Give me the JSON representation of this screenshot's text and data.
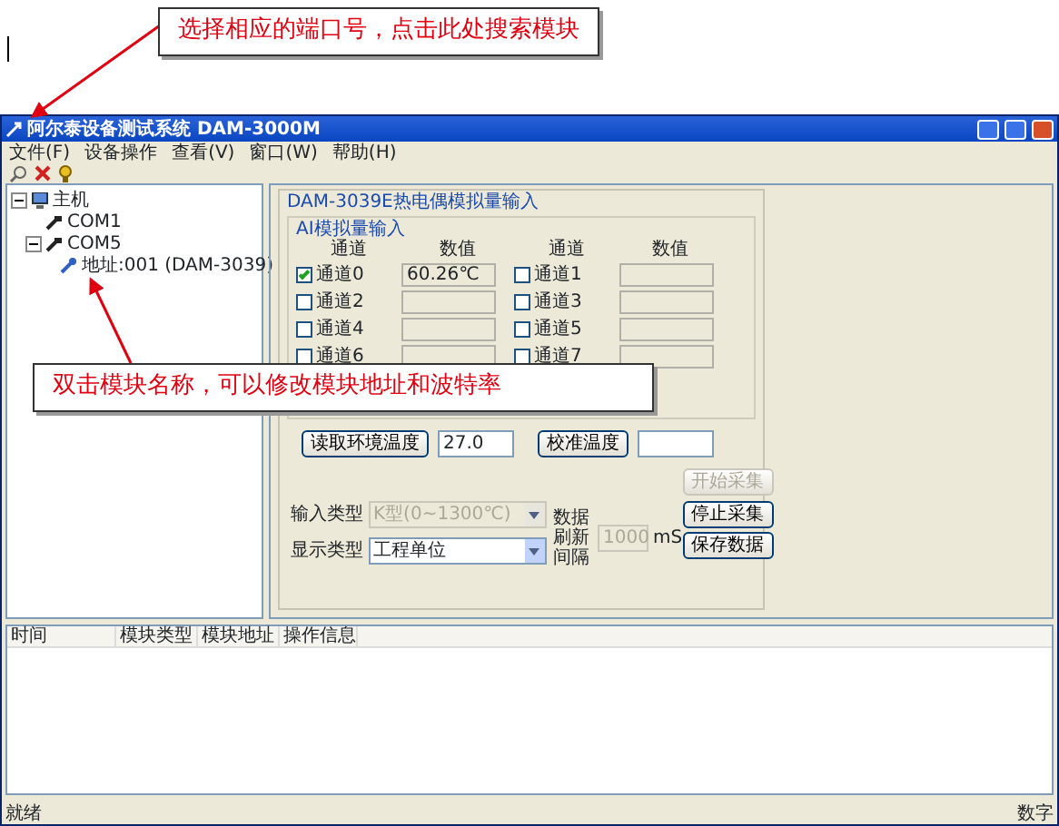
{
  "annotations": [
    {
      "text": "选择相应的端口号，点击此处搜索模块"
    },
    {
      "text": "双击模块名称，可以修改模块地址和波特率"
    }
  ],
  "window": {
    "title": "阿尔泰设备测试系统 DAM-3000M"
  },
  "menu": [
    "文件(F)",
    "设备操作",
    "查看(V)",
    "窗口(W)",
    "帮助(H)"
  ],
  "tree": [
    {
      "label": "主机",
      "expanded": true,
      "kind": "host",
      "children": [
        {
          "label": "COM1",
          "kind": "port"
        },
        {
          "label": "COM5",
          "kind": "port",
          "expanded": true,
          "children": [
            {
              "label": "地址:001 (DAM-3039)",
              "kind": "module"
            }
          ]
        }
      ]
    }
  ],
  "module_panel": {
    "title": "DAM-3039E热电偶模拟量输入",
    "group_title": "AI模拟量输入",
    "column_headers": [
      "通道",
      "数值",
      "通道",
      "数值"
    ],
    "channels": [
      {
        "label": "通道0",
        "checked": true,
        "value": "60.26℃"
      },
      {
        "label": "通道1",
        "checked": false
      },
      {
        "label": "通道2",
        "checked": false
      },
      {
        "label": "通道3",
        "checked": false
      },
      {
        "label": "通道4",
        "checked": false
      },
      {
        "label": "通道5",
        "checked": false
      },
      {
        "label": "通道6",
        "checked": false
      },
      {
        "label": "通道7",
        "checked": false
      }
    ],
    "ambient_button": "读取环境温度",
    "ambient_value": "27.0",
    "calibrate_button": "校准温度",
    "input_type": {
      "label": "输入类型",
      "value": "K型(0~1300℃)",
      "disabled": true
    },
    "display_type": {
      "label": "显示类型",
      "value": "工程单位",
      "disabled": false
    },
    "refresh": {
      "label": "数据刷新间隔",
      "value": "1000",
      "unit": "mS",
      "disabled": true
    },
    "buttons": [
      {
        "label": "开始采集",
        "disabled": true
      },
      {
        "label": "停止采集",
        "disabled": false
      },
      {
        "label": "保存数据",
        "disabled": false
      }
    ]
  },
  "log_table": {
    "columns": [
      "时间",
      "模块类型",
      "模块地址",
      "操作信息"
    ]
  },
  "status_bar": [
    "就绪",
    "数字"
  ]
}
